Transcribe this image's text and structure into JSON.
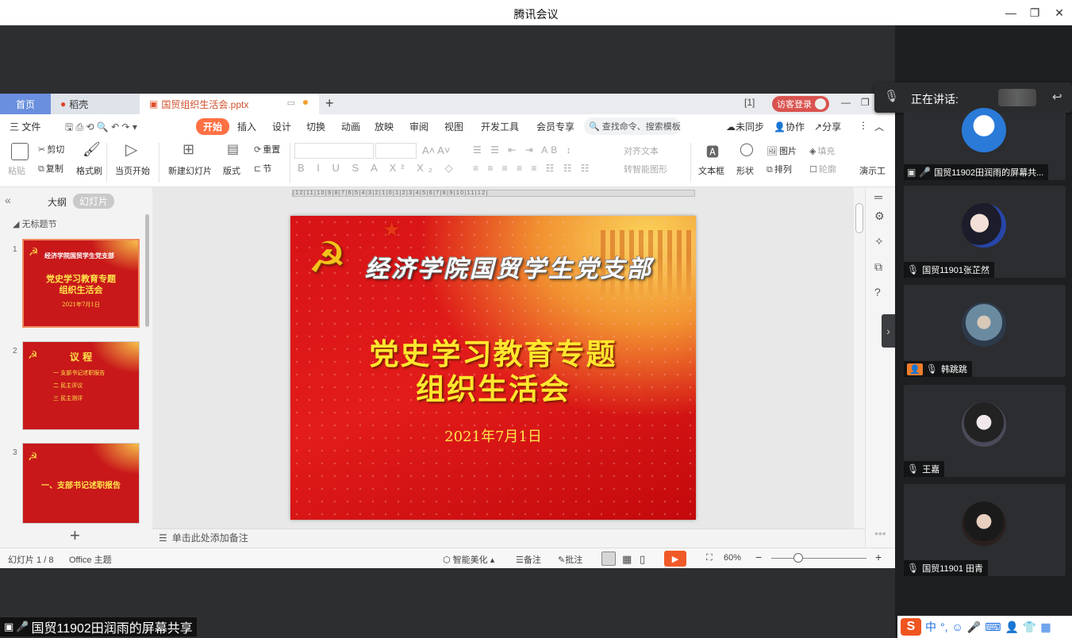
{
  "window": {
    "title": "腾讯会议"
  },
  "wps": {
    "tabs": {
      "home": "首页",
      "daoke": "稻壳",
      "file": "国贸组织生活会.pptx",
      "login": "访客登录"
    },
    "menu": [
      "三 文件",
      "开始",
      "插入",
      "设计",
      "切换",
      "动画",
      "放映",
      "审阅",
      "视图",
      "开发工具",
      "会员专享"
    ],
    "search_placeholder": "查找命令、搜索模板",
    "menu_right": {
      "sync": "未同步",
      "collab": "协作",
      "share": "分享"
    },
    "ribbon": {
      "paste": "粘贴",
      "cut": "剪切",
      "copy": "复制",
      "format_painter": "格式刷",
      "start_from_current": "当页开始",
      "new_slide": "新建幻灯片",
      "layout": "版式",
      "section": "节",
      "reset": "重置",
      "align_text": "对齐文本",
      "smartart": "转智能图形",
      "textbox": "文本框",
      "shape": "形状",
      "picture": "图片",
      "arrange": "排列",
      "fill": "填充",
      "outline": "轮廓",
      "present": "演示工"
    },
    "pane": {
      "outline": "大纲",
      "slides": "幻灯片",
      "section": "无标题节"
    },
    "thumbnails": [
      {
        "num": "1",
        "title": "党史学习教育专题\n组织生活会",
        "sub": "2021年7月1日",
        "header": "经济学院国贸学生党支部"
      },
      {
        "num": "2",
        "title": "议  程",
        "items": [
          "一 支部书记述职报告",
          "二 民主评议",
          "三 民主测评"
        ]
      },
      {
        "num": "3",
        "title": "一、支部书记述职报告"
      }
    ],
    "ruler_text": "|12|11|10|9|8|7|6|5|4|3|2|1|0|1|2|3|4|5|6|7|8|9|10|11|12|",
    "slide": {
      "branch": "经济学院国贸学生党支部",
      "title_line1": "党史学习教育专题",
      "title_line2": "组织生活会",
      "date": "2021年7月1日"
    },
    "notes_hint": "单击此处添加备注",
    "status": {
      "slide_count": "幻灯片 1 / 8",
      "theme": "Office 主题",
      "beautify": "智能美化",
      "notes": "备注",
      "comment": "批注",
      "zoom": "60%"
    }
  },
  "share_caption": "国贸11902田润雨的屏幕共享",
  "meeting": {
    "speaking_label": "正在讲话:",
    "participants": [
      {
        "name": "国贸11902田润雨的屏幕共..."
      },
      {
        "name": "国贸11901张芷然"
      },
      {
        "name": "韩跳跳"
      },
      {
        "name": "王嘉"
      },
      {
        "name": "国贸11901 田青"
      }
    ]
  },
  "ime": {
    "lang": "中"
  },
  "colors": {
    "accent": "#ff7043",
    "slide_red": "#d71316",
    "slide_yellow": "#ffe62e",
    "meeting_bg": "#2d2e30"
  }
}
